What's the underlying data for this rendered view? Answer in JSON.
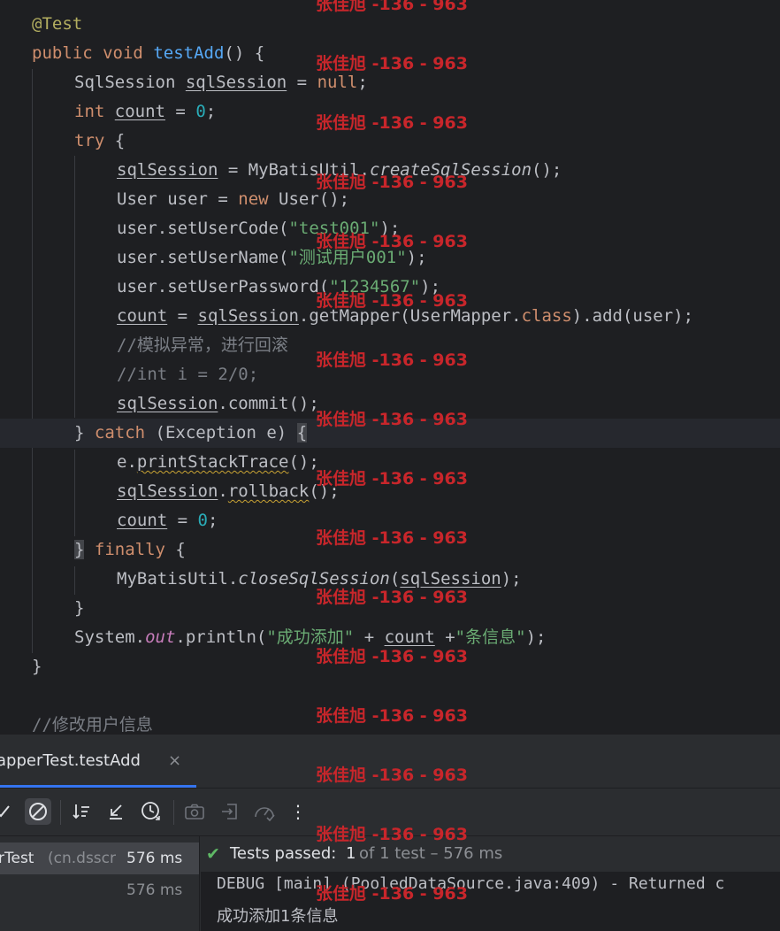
{
  "code": {
    "l1_annotation": "@Test",
    "l2_public": "public",
    "l2_void": "void",
    "l2_method": "testAdd",
    "l2_rest": "() {",
    "l3_type": "SqlSession",
    "l3_var": "sqlSession",
    "l3_eq": " = ",
    "l3_null": "null",
    "l3_end": ";",
    "l4_int": "int",
    "l4_var": "count",
    "l4_eq": " = ",
    "l4_num": "0",
    "l4_end": ";",
    "l5_try": "try",
    "l5_brace": " {",
    "l6_var": "sqlSession",
    "l6_mid": " = MyBatisUtil.",
    "l6_method": "createSqlSession",
    "l6_end": "();",
    "l7_a": "User user = ",
    "l7_new": "new",
    "l7_b": " User();",
    "l8_a": "user.setUserCode(",
    "l8_str": "\"test001\"",
    "l8_b": ");",
    "l9_a": "user.setUserName(",
    "l9_str": "\"测试用户001\"",
    "l9_b": ");",
    "l10_a": "user.setUserPassword(",
    "l10_str": "\"1234567\"",
    "l10_b": ");",
    "l11_var": "count",
    "l11_eq": " = ",
    "l11_var2": "sqlSession",
    "l11_mid": ".getMapper(UserMapper.",
    "l11_class": "class",
    "l11_end": ").add(user);",
    "l12_comment": "//模拟异常，进行回滚",
    "l13_comment": "//int i = 2/0;",
    "l14_var": "sqlSession",
    "l14_end": ".commit();",
    "l15_close": "} ",
    "l15_catch": "catch",
    "l15_mid": " (Exception e) ",
    "l15_brace": "{",
    "l16_a": "e.",
    "l16_method": "printStackTrace",
    "l16_end": "();",
    "l17_var": "sqlSession",
    "l17_dot": ".",
    "l17_method": "rollback",
    "l17_end": "();",
    "l18_var": "count",
    "l18_eq": " = ",
    "l18_num": "0",
    "l18_end": ";",
    "l19_close": "}",
    "l19_finally": " finally",
    "l19_brace": " {",
    "l20_a": "MyBatisUtil.",
    "l20_method": "closeSqlSession",
    "l20_p": "(",
    "l20_var": "sqlSession",
    "l20_end": ");",
    "l21_close": "}",
    "l22_a": "System.",
    "l22_out": "out",
    "l22_b": ".println(",
    "l22_str1": "\"成功添加\"",
    "l22_plus": " + ",
    "l22_var": "count",
    "l22_plus2": " +",
    "l22_str2": "\"条信息\"",
    "l22_end": ");",
    "l23_close": "}",
    "l25_comment": "//修改用户信息"
  },
  "watermark": "张佳旭 -136 - 963",
  "run_panel": {
    "tab_label": "apperTest.testAdd",
    "tab_close": "×",
    "toolbar_more": "⋮",
    "tree_row1_name": "rTest",
    "tree_row1_pkg": "(cn.dsscr",
    "tree_row1_time": "576 ms",
    "tree_row2_time": "576 ms",
    "status_check": "✔",
    "status_text": "Tests passed:",
    "status_count": "1",
    "status_detail": "of 1 test – 576 ms",
    "output_line1": "DEBUG [main] (PooledDataSource.java:409) - Returned c",
    "output_line2": "成功添加1条信息"
  },
  "colors": {
    "keyword": "#cf8e6d",
    "method": "#56a8f5",
    "string": "#6aab73",
    "number": "#2aacb8",
    "comment": "#7a7e85",
    "annotation": "#b3ae60",
    "watermark": "#c8262b",
    "success": "#5fb865",
    "accent": "#3574f0"
  }
}
